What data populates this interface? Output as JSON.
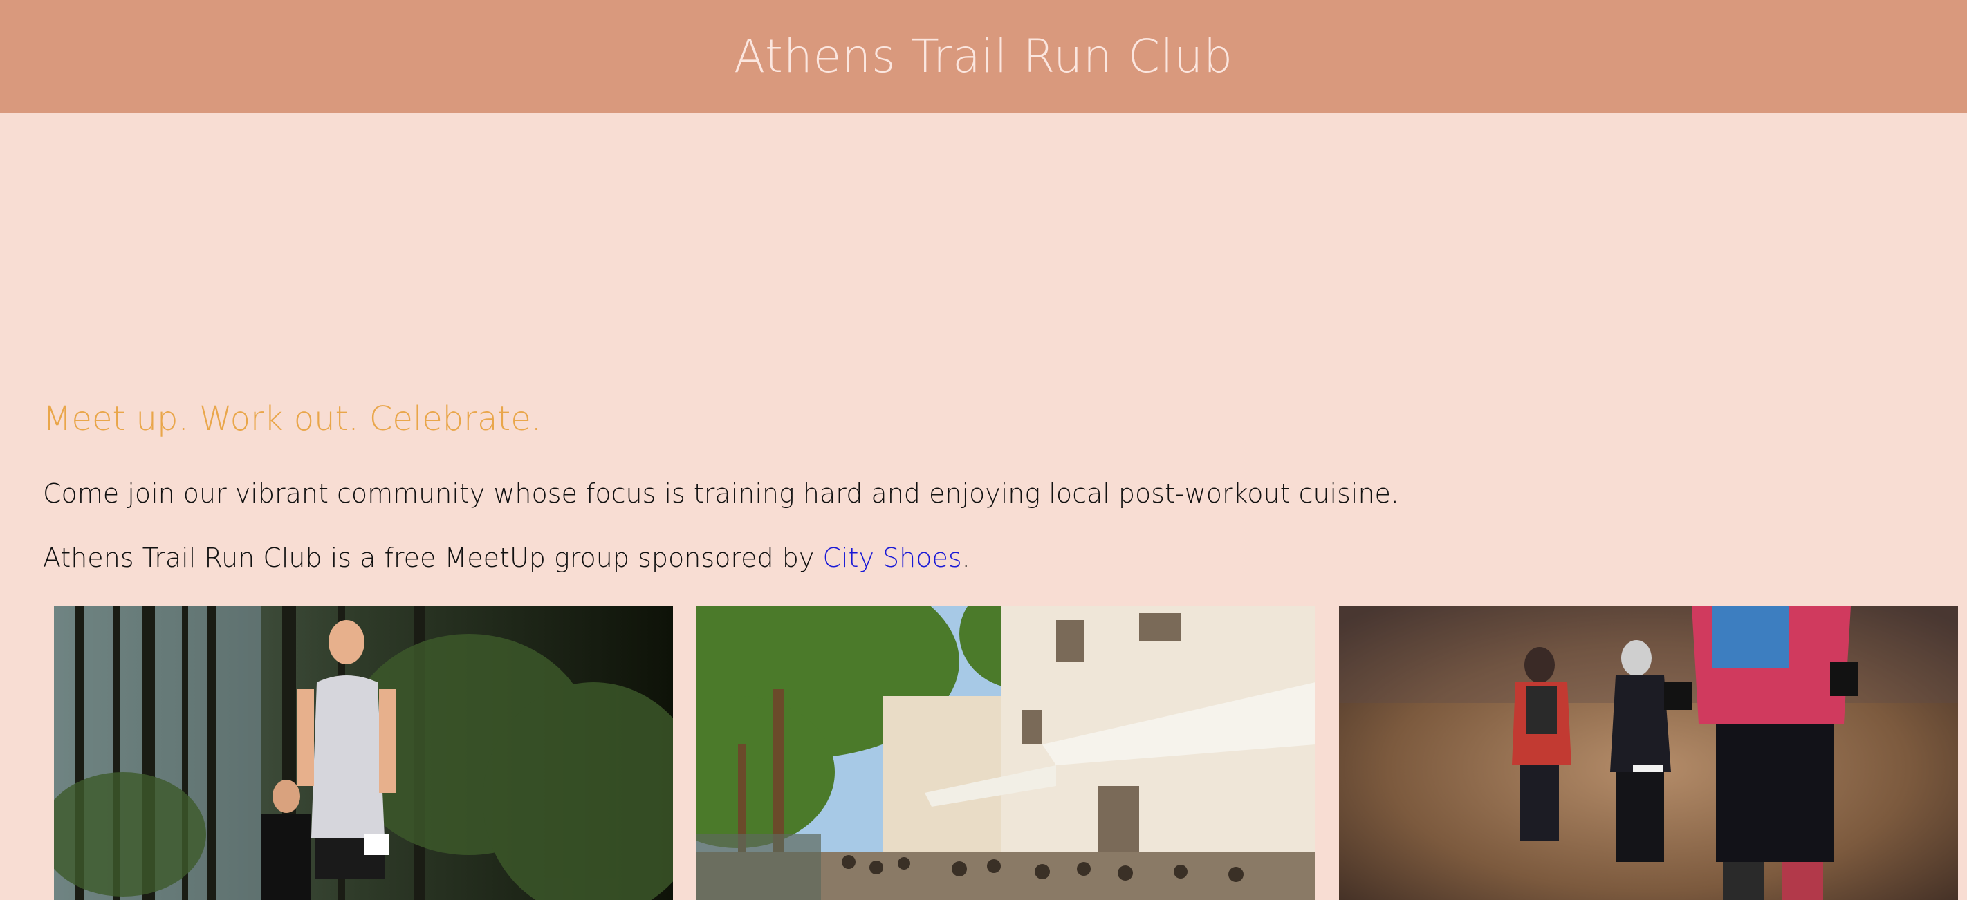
{
  "header": {
    "title": "Athens Trail Run Club",
    "background_color": "#d9997d",
    "title_color": "#fbe6df"
  },
  "main": {
    "tagline": "Meet up. Work out. Celebrate.",
    "tagline_color": "#e9a64a",
    "intro": "Come join our vibrant community whose focus is training hard and enjoying local post-workout cuisine.",
    "sponsor_prefix": "Athens Trail Run Club is a free MeetUp group sponsored by ",
    "sponsor_link": "City Shoes",
    "sponsor_suffix": ".",
    "link_color": "#1a1ad6",
    "page_background": "#f8ddd3"
  },
  "gallery": {
    "images": [
      {
        "name": "forest-trail-runners-photo"
      },
      {
        "name": "athens-street-cafe-photo"
      },
      {
        "name": "trail-runners-backs-photo"
      }
    ]
  }
}
